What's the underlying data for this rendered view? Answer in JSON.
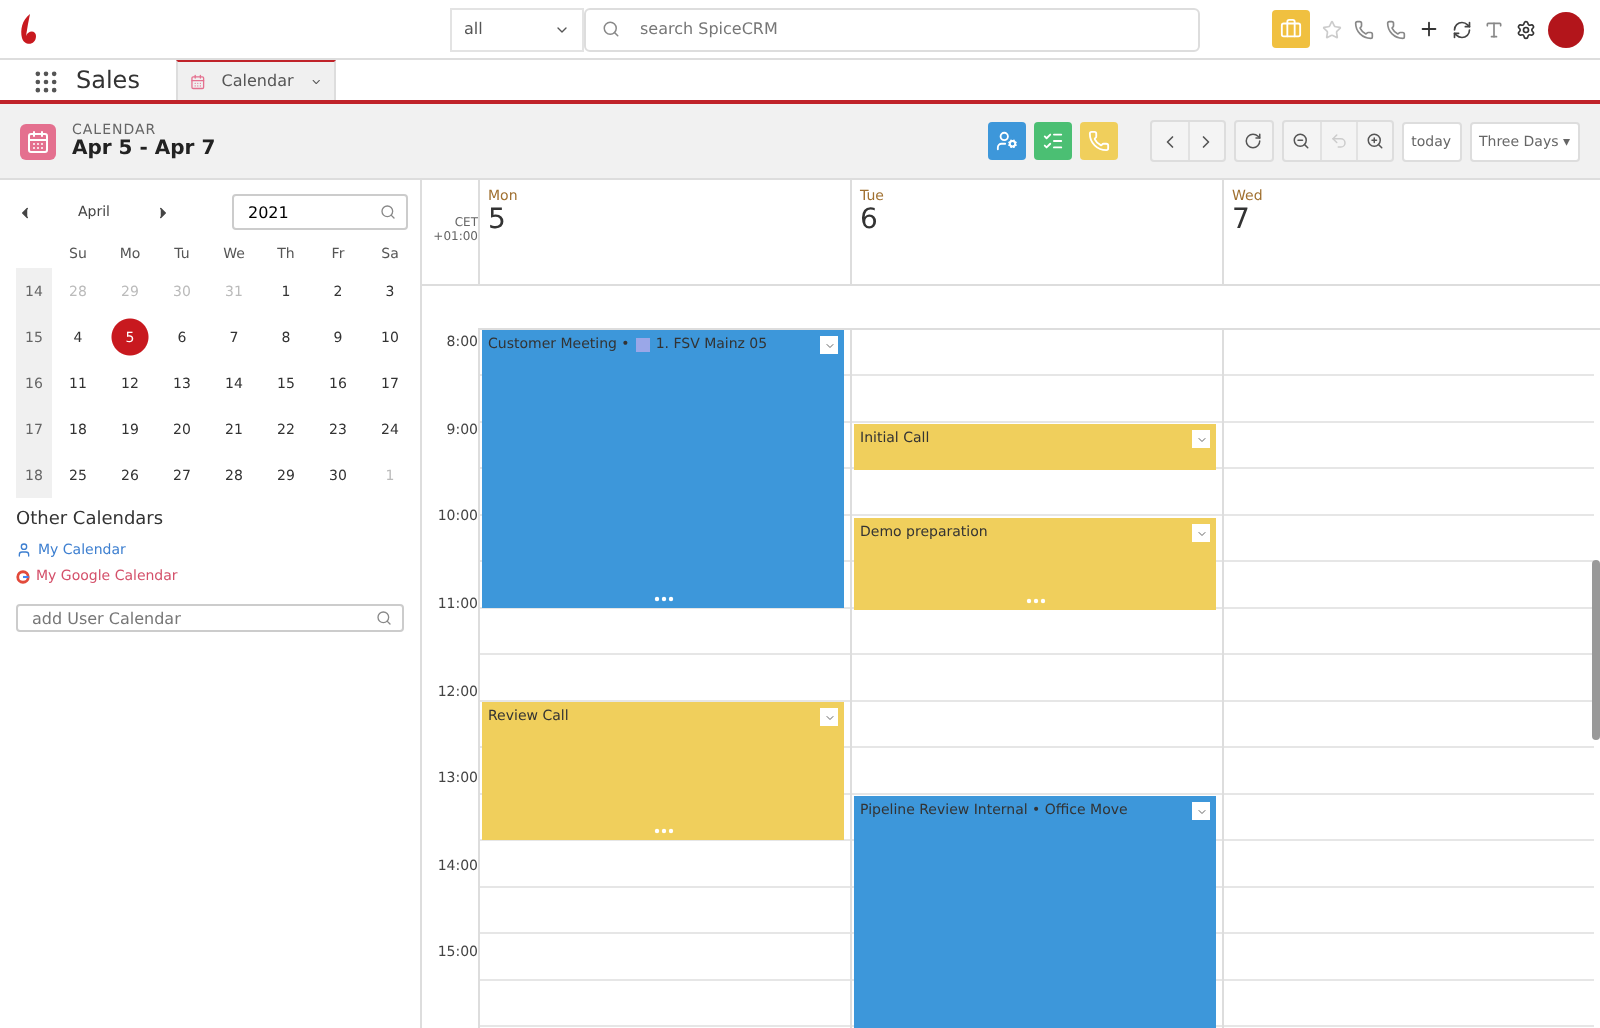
{
  "topbar": {
    "module_select": "all",
    "search": {
      "placeholder": "search SpiceCRM"
    }
  },
  "nav": {
    "app": "Sales",
    "tab": {
      "label": "Calendar",
      "selected": true
    }
  },
  "header": {
    "module": "CALENDAR",
    "title": "Apr 5 - Apr 7",
    "today": "today",
    "view": "Three Days",
    "view_caret": "▾"
  },
  "mini_calendar": {
    "month": "April",
    "year": "2021",
    "weekdays": [
      "Su",
      "Mo",
      "Tu",
      "We",
      "Th",
      "Fr",
      "Sa"
    ],
    "weeks": [
      {
        "number": "14",
        "days": [
          {
            "label": "28",
            "muted": true,
            "selected": false
          },
          {
            "label": "29",
            "muted": true,
            "selected": false
          },
          {
            "label": "30",
            "muted": true,
            "selected": false
          },
          {
            "label": "31",
            "muted": true,
            "selected": false
          },
          {
            "label": "1",
            "muted": false,
            "selected": false
          },
          {
            "label": "2",
            "muted": false,
            "selected": false
          },
          {
            "label": "3",
            "muted": false,
            "selected": false
          }
        ]
      },
      {
        "number": "15",
        "days": [
          {
            "label": "4",
            "muted": false,
            "selected": false
          },
          {
            "label": "5",
            "muted": false,
            "selected": true
          },
          {
            "label": "6",
            "muted": false,
            "selected": false
          },
          {
            "label": "7",
            "muted": false,
            "selected": false
          },
          {
            "label": "8",
            "muted": false,
            "selected": false
          },
          {
            "label": "9",
            "muted": false,
            "selected": false
          },
          {
            "label": "10",
            "muted": false,
            "selected": false
          }
        ]
      },
      {
        "number": "16",
        "days": [
          {
            "label": "11",
            "muted": false,
            "selected": false
          },
          {
            "label": "12",
            "muted": false,
            "selected": false
          },
          {
            "label": "13",
            "muted": false,
            "selected": false
          },
          {
            "label": "14",
            "muted": false,
            "selected": false
          },
          {
            "label": "15",
            "muted": false,
            "selected": false
          },
          {
            "label": "16",
            "muted": false,
            "selected": false
          },
          {
            "label": "17",
            "muted": false,
            "selected": false
          }
        ]
      },
      {
        "number": "17",
        "days": [
          {
            "label": "18",
            "muted": false,
            "selected": false
          },
          {
            "label": "19",
            "muted": false,
            "selected": false
          },
          {
            "label": "20",
            "muted": false,
            "selected": false
          },
          {
            "label": "21",
            "muted": false,
            "selected": false
          },
          {
            "label": "22",
            "muted": false,
            "selected": false
          },
          {
            "label": "23",
            "muted": false,
            "selected": false
          },
          {
            "label": "24",
            "muted": false,
            "selected": false
          }
        ]
      },
      {
        "number": "18",
        "days": [
          {
            "label": "25",
            "muted": false,
            "selected": false
          },
          {
            "label": "26",
            "muted": false,
            "selected": false
          },
          {
            "label": "27",
            "muted": false,
            "selected": false
          },
          {
            "label": "28",
            "muted": false,
            "selected": false
          },
          {
            "label": "29",
            "muted": false,
            "selected": false
          },
          {
            "label": "30",
            "muted": false,
            "selected": false
          },
          {
            "label": "1",
            "muted": true,
            "selected": false
          }
        ]
      }
    ]
  },
  "other_calendars": {
    "title": "Other Calendars",
    "items": [
      {
        "kind": "user",
        "label": "My Calendar"
      },
      {
        "kind": "google",
        "label": "My Google Calendar"
      }
    ],
    "add_field": {
      "placeholder": "add User Calendar"
    }
  },
  "grid": {
    "timezone": [
      "CET",
      "+01:00"
    ],
    "hours": [
      "8:00",
      "9:00",
      "10:00",
      "11:00",
      "12:00",
      "13:00",
      "14:00",
      "15:00"
    ],
    "days": [
      {
        "weekday": "Mon",
        "date": "5",
        "events": [
          {
            "title": "Customer Meeting • ",
            "extra": "1. FSV Mainz 05",
            "color": "#3d97da"
          },
          {
            "title": "Review Call",
            "color": "#f0cf5c"
          }
        ]
      },
      {
        "weekday": "Tue",
        "date": "6",
        "events": [
          {
            "title": "Initial Call",
            "color": "#f0cf5c"
          },
          {
            "title": "Demo preparation",
            "color": "#f0cf5c"
          },
          {
            "title": "Pipeline Review Internal • Office Move",
            "color": "#3d97da"
          }
        ]
      },
      {
        "weekday": "Wed",
        "date": "7"
      }
    ]
  }
}
